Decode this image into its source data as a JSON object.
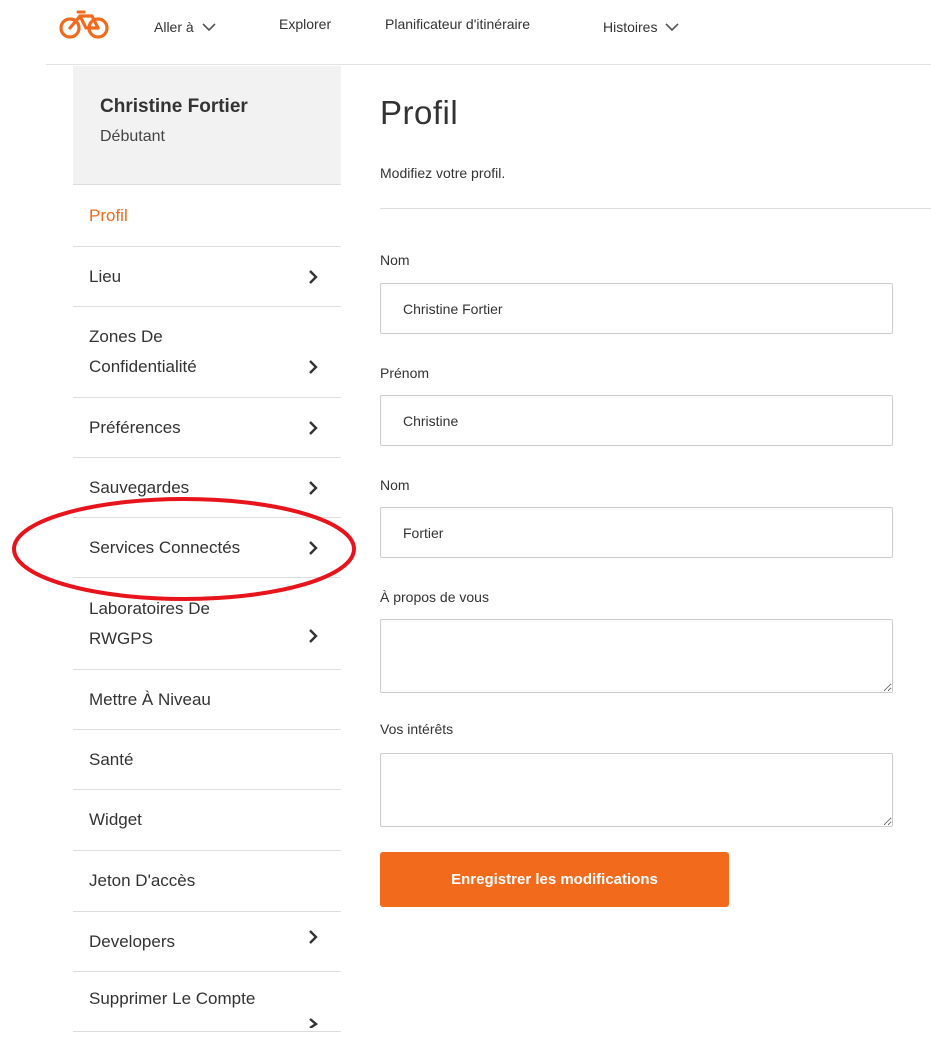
{
  "nav": {
    "logo_icon": "bicycle-icon",
    "goto_label": "Aller à",
    "explore_label": "Explorer",
    "planner_label": "Planificateur d'itinéraire",
    "stories_label": "Histoires",
    "brand_color": "#f26a1b"
  },
  "user": {
    "name": "Christine Fortier",
    "level": "Débutant"
  },
  "sidebar": {
    "items": [
      {
        "label": "Profil",
        "active": true,
        "has_arrow": false
      },
      {
        "label": "Lieu",
        "has_arrow": true
      },
      {
        "label": "Zones De",
        "label2": "Confidentialité",
        "has_arrow": true
      },
      {
        "label": "Préférences",
        "has_arrow": true
      },
      {
        "label": "Sauvegardes",
        "has_arrow": true
      },
      {
        "label": "Services Connectés",
        "has_arrow": true,
        "highlighted": true
      },
      {
        "label": "Laboratoires De",
        "label2": "RWGPS",
        "has_arrow": true
      },
      {
        "label": "Mettre À Niveau",
        "has_arrow": false
      },
      {
        "label": "Santé",
        "has_arrow": false
      },
      {
        "label": "Widget",
        "has_arrow": false
      },
      {
        "label": "Jeton D'accès",
        "has_arrow": false
      },
      {
        "label": "Developers",
        "has_arrow": true
      },
      {
        "label": "Supprimer Le Compte",
        "has_arrow": true
      }
    ],
    "highlight_color": "#e8141b"
  },
  "main": {
    "title": "Profil",
    "subtitle": "Modifiez votre profil.",
    "fields": {
      "full_name_label": "Nom",
      "full_name_value": "Christine Fortier",
      "first_name_label": "Prénom",
      "first_name_value": "Christine",
      "last_name_label": "Nom",
      "last_name_value": "Fortier",
      "about_label": "À propos de vous",
      "about_value": "",
      "interests_label": "Vos intérêts",
      "interests_value": ""
    },
    "save_label": "Enregistrer les modifications"
  }
}
